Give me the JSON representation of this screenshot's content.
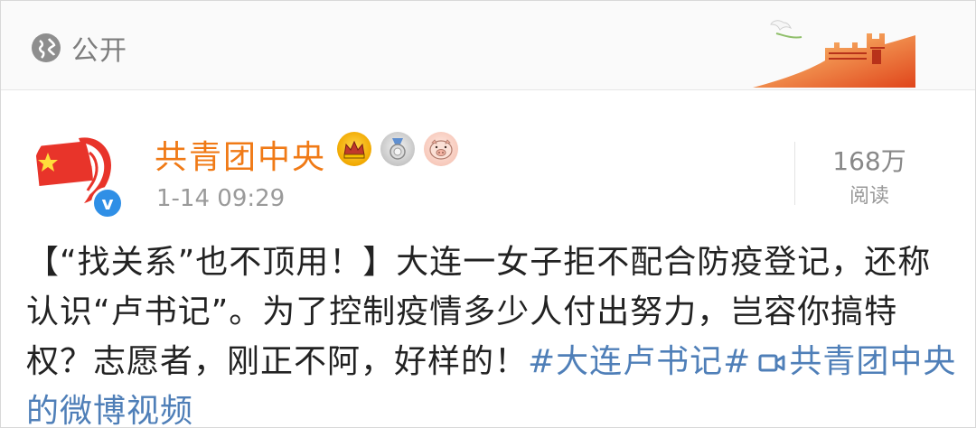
{
  "visibility": {
    "icon": "globe-icon",
    "label": "公开"
  },
  "header_decoration": {
    "icon": "great-wall-illustration"
  },
  "post": {
    "author": "共青团中央",
    "badges": [
      {
        "icon": "crown-badge-icon"
      },
      {
        "icon": "medal-badge-icon"
      },
      {
        "icon": "pig-badge-icon"
      }
    ],
    "verified_icon": "verified-badge-icon",
    "timestamp": "1-14 09:29",
    "read_count": "168万",
    "read_label": "阅读",
    "text_main": "【“找关系”也不顶用！】大连一女子拒不配合防疫登记，还称认识“卢书记”。为了控制疫情多少人付出努力，岂容你搞特权？志愿者，刚正不阿，好样的！",
    "hashtag": "#大连卢书记#",
    "video_icon": "video-icon",
    "video_link": "共青团中央的微博视频"
  },
  "colors": {
    "author": "#f07a16",
    "link": "#4f7fb8",
    "verified": "#2f8fe6"
  }
}
